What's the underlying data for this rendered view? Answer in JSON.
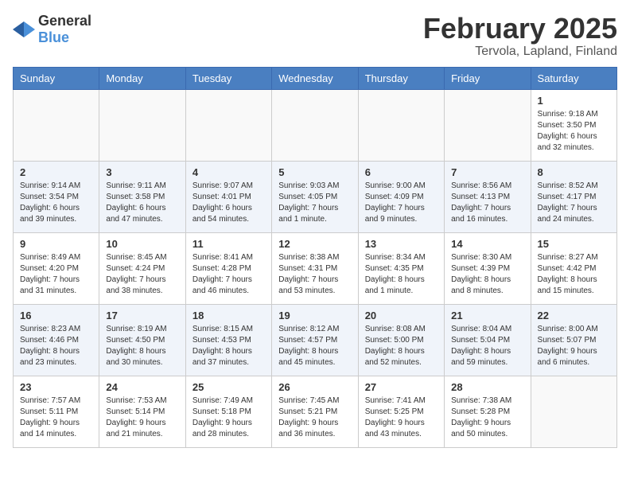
{
  "logo": {
    "text_general": "General",
    "text_blue": "Blue"
  },
  "title": "February 2025",
  "location": "Tervola, Lapland, Finland",
  "weekdays": [
    "Sunday",
    "Monday",
    "Tuesday",
    "Wednesday",
    "Thursday",
    "Friday",
    "Saturday"
  ],
  "weeks": [
    [
      {
        "day": "",
        "info": ""
      },
      {
        "day": "",
        "info": ""
      },
      {
        "day": "",
        "info": ""
      },
      {
        "day": "",
        "info": ""
      },
      {
        "day": "",
        "info": ""
      },
      {
        "day": "",
        "info": ""
      },
      {
        "day": "1",
        "info": "Sunrise: 9:18 AM\nSunset: 3:50 PM\nDaylight: 6 hours and 32 minutes."
      }
    ],
    [
      {
        "day": "2",
        "info": "Sunrise: 9:14 AM\nSunset: 3:54 PM\nDaylight: 6 hours and 39 minutes."
      },
      {
        "day": "3",
        "info": "Sunrise: 9:11 AM\nSunset: 3:58 PM\nDaylight: 6 hours and 47 minutes."
      },
      {
        "day": "4",
        "info": "Sunrise: 9:07 AM\nSunset: 4:01 PM\nDaylight: 6 hours and 54 minutes."
      },
      {
        "day": "5",
        "info": "Sunrise: 9:03 AM\nSunset: 4:05 PM\nDaylight: 7 hours and 1 minute."
      },
      {
        "day": "6",
        "info": "Sunrise: 9:00 AM\nSunset: 4:09 PM\nDaylight: 7 hours and 9 minutes."
      },
      {
        "day": "7",
        "info": "Sunrise: 8:56 AM\nSunset: 4:13 PM\nDaylight: 7 hours and 16 minutes."
      },
      {
        "day": "8",
        "info": "Sunrise: 8:52 AM\nSunset: 4:17 PM\nDaylight: 7 hours and 24 minutes."
      }
    ],
    [
      {
        "day": "9",
        "info": "Sunrise: 8:49 AM\nSunset: 4:20 PM\nDaylight: 7 hours and 31 minutes."
      },
      {
        "day": "10",
        "info": "Sunrise: 8:45 AM\nSunset: 4:24 PM\nDaylight: 7 hours and 38 minutes."
      },
      {
        "day": "11",
        "info": "Sunrise: 8:41 AM\nSunset: 4:28 PM\nDaylight: 7 hours and 46 minutes."
      },
      {
        "day": "12",
        "info": "Sunrise: 8:38 AM\nSunset: 4:31 PM\nDaylight: 7 hours and 53 minutes."
      },
      {
        "day": "13",
        "info": "Sunrise: 8:34 AM\nSunset: 4:35 PM\nDaylight: 8 hours and 1 minute."
      },
      {
        "day": "14",
        "info": "Sunrise: 8:30 AM\nSunset: 4:39 PM\nDaylight: 8 hours and 8 minutes."
      },
      {
        "day": "15",
        "info": "Sunrise: 8:27 AM\nSunset: 4:42 PM\nDaylight: 8 hours and 15 minutes."
      }
    ],
    [
      {
        "day": "16",
        "info": "Sunrise: 8:23 AM\nSunset: 4:46 PM\nDaylight: 8 hours and 23 minutes."
      },
      {
        "day": "17",
        "info": "Sunrise: 8:19 AM\nSunset: 4:50 PM\nDaylight: 8 hours and 30 minutes."
      },
      {
        "day": "18",
        "info": "Sunrise: 8:15 AM\nSunset: 4:53 PM\nDaylight: 8 hours and 37 minutes."
      },
      {
        "day": "19",
        "info": "Sunrise: 8:12 AM\nSunset: 4:57 PM\nDaylight: 8 hours and 45 minutes."
      },
      {
        "day": "20",
        "info": "Sunrise: 8:08 AM\nSunset: 5:00 PM\nDaylight: 8 hours and 52 minutes."
      },
      {
        "day": "21",
        "info": "Sunrise: 8:04 AM\nSunset: 5:04 PM\nDaylight: 8 hours and 59 minutes."
      },
      {
        "day": "22",
        "info": "Sunrise: 8:00 AM\nSunset: 5:07 PM\nDaylight: 9 hours and 6 minutes."
      }
    ],
    [
      {
        "day": "23",
        "info": "Sunrise: 7:57 AM\nSunset: 5:11 PM\nDaylight: 9 hours and 14 minutes."
      },
      {
        "day": "24",
        "info": "Sunrise: 7:53 AM\nSunset: 5:14 PM\nDaylight: 9 hours and 21 minutes."
      },
      {
        "day": "25",
        "info": "Sunrise: 7:49 AM\nSunset: 5:18 PM\nDaylight: 9 hours and 28 minutes."
      },
      {
        "day": "26",
        "info": "Sunrise: 7:45 AM\nSunset: 5:21 PM\nDaylight: 9 hours and 36 minutes."
      },
      {
        "day": "27",
        "info": "Sunrise: 7:41 AM\nSunset: 5:25 PM\nDaylight: 9 hours and 43 minutes."
      },
      {
        "day": "28",
        "info": "Sunrise: 7:38 AM\nSunset: 5:28 PM\nDaylight: 9 hours and 50 minutes."
      },
      {
        "day": "",
        "info": ""
      }
    ]
  ]
}
